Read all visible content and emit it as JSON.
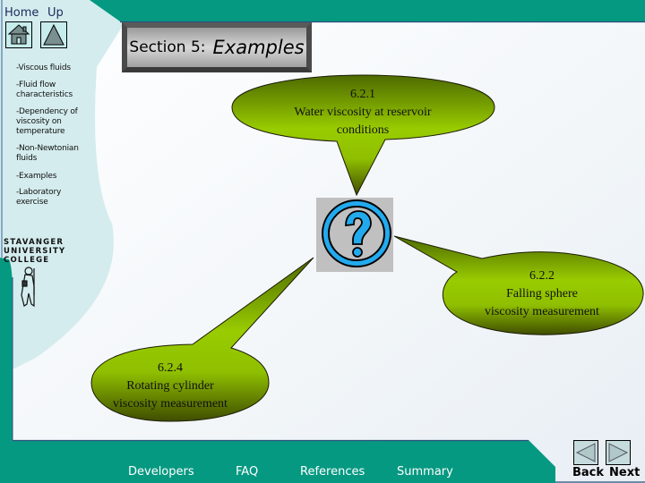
{
  "top_nav": {
    "home_label": "Home",
    "up_label": "Up"
  },
  "section": {
    "prefix": "Section 5:",
    "title": "Examples"
  },
  "sidebar": {
    "items": [
      {
        "label": "-Viscous fluids"
      },
      {
        "label": "-Fluid flow characteristics"
      },
      {
        "label": "-Dependency of viscosity on temperature"
      },
      {
        "label": "-Non-Newtonian fluids"
      },
      {
        "label": "-Examples"
      },
      {
        "label": "-Laboratory exercise"
      }
    ],
    "logo": {
      "line1": "STAVANGER",
      "line2": "UNIVERSITY",
      "line3": "COLLEGE"
    }
  },
  "bubbles": [
    {
      "number": "6.2.1",
      "line1": "Water viscosity at reservoir",
      "line2": "conditions"
    },
    {
      "number": "6.2.2",
      "line1": "Falling sphere",
      "line2": "viscosity measurement"
    },
    {
      "number": "6.2.4",
      "line1": "Rotating cylinder",
      "line2": "viscosity measurement"
    }
  ],
  "center_icon": "question-mark-icon",
  "footer": {
    "links": [
      {
        "label": "Developers"
      },
      {
        "label": "FAQ"
      },
      {
        "label": "References"
      },
      {
        "label": "Summary"
      }
    ],
    "back_label": "Back",
    "next_label": "Next"
  },
  "colors": {
    "teal": "#069982",
    "light_cyan": "#d6eef0",
    "bubble_green_light": "#99cc00",
    "bubble_green_dark": "#4a5a00",
    "question_blue": "#22aaee"
  }
}
